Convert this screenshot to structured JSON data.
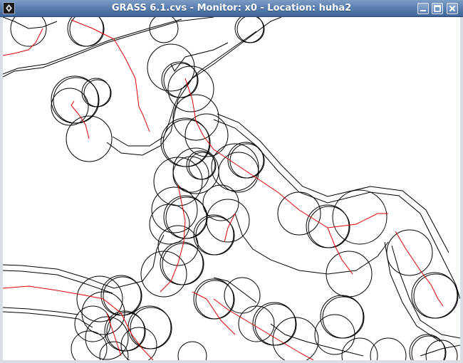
{
  "window": {
    "title": "GRASS 6.1.cvs - Monitor: x0 - Location: huha2"
  },
  "controls": {
    "minimize": "minimize-icon",
    "maximize": "maximize-icon",
    "close": "close-icon"
  },
  "map": {
    "buffer_color": "#000000",
    "line_color": "#e00000",
    "background": "#ffffff"
  }
}
